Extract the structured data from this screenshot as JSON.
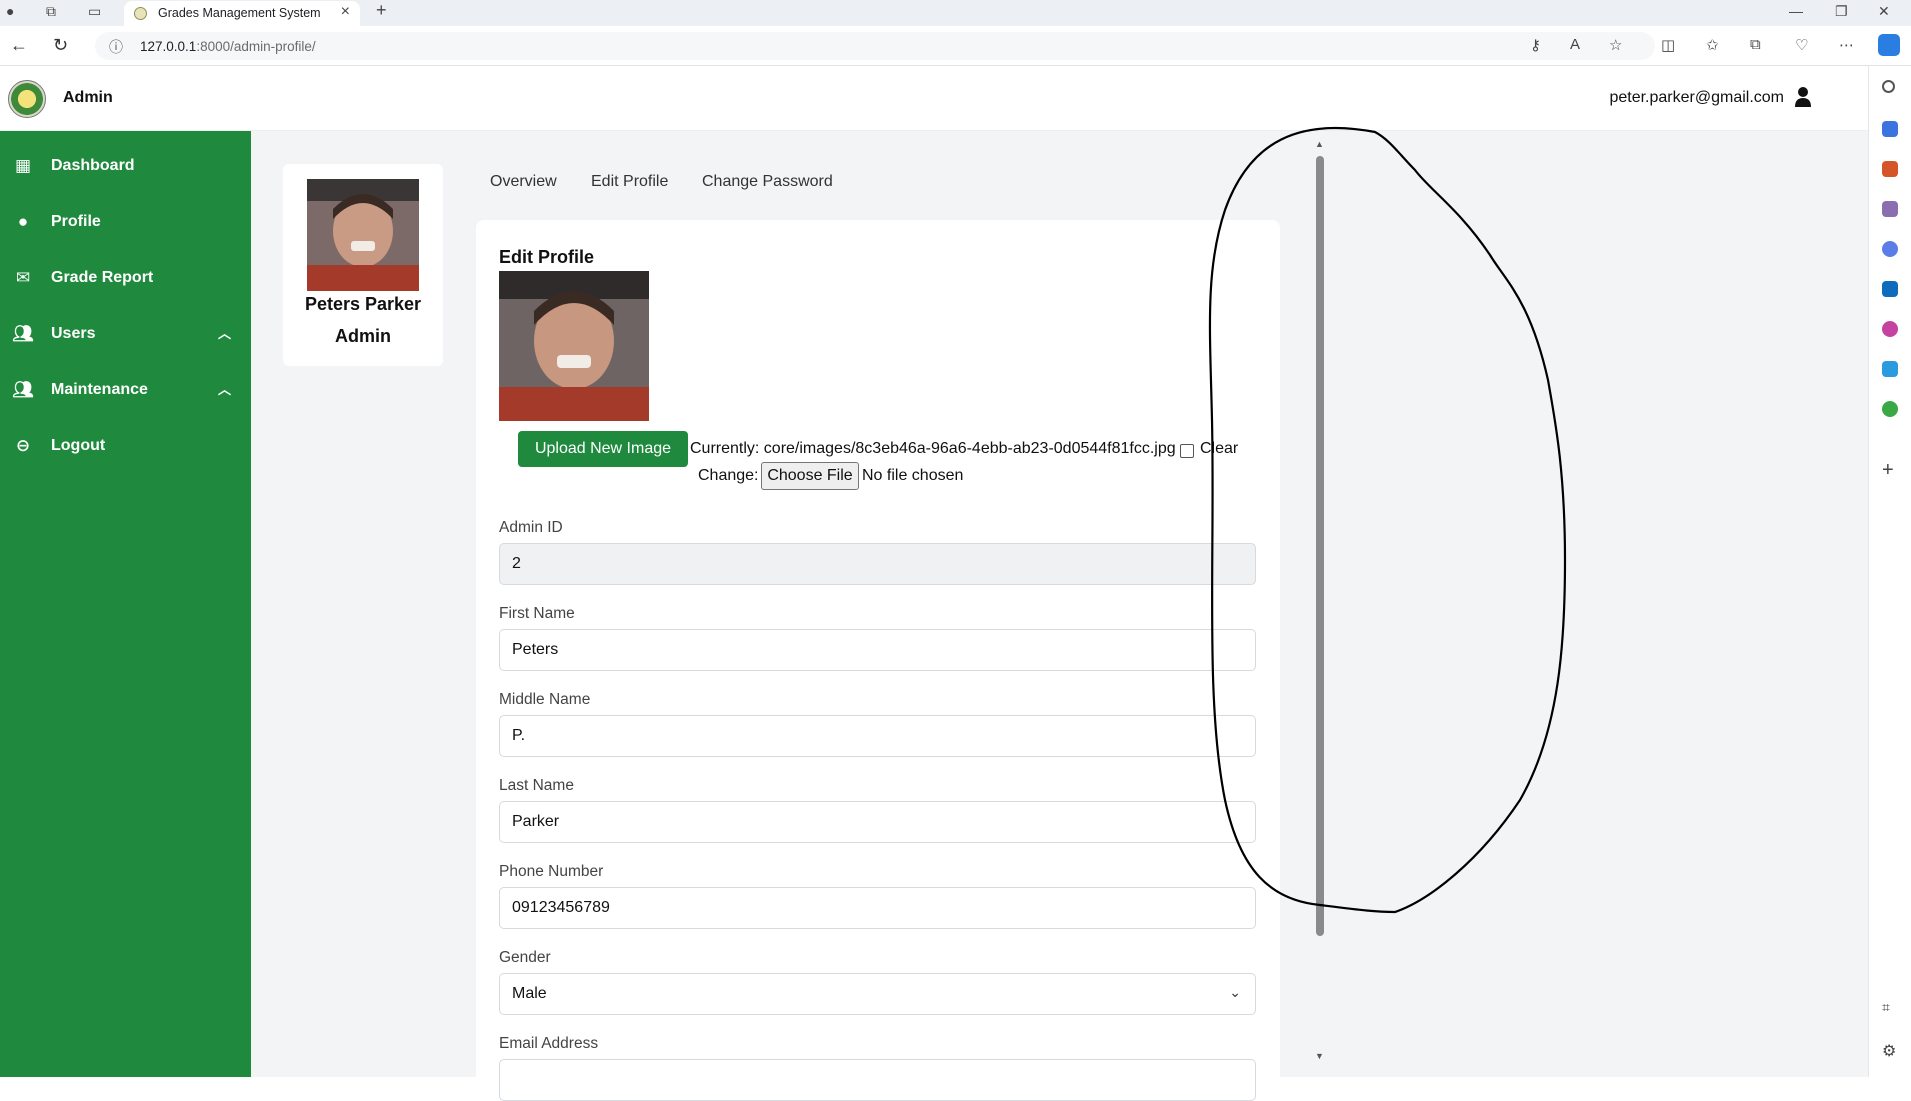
{
  "browser": {
    "tab_title": "Grades Management System",
    "url_host": "127.0.0.1",
    "url_rest": ":8000/admin-profile/",
    "new_tab_icon": "plus-icon"
  },
  "header": {
    "app_title": "Admin",
    "user_email": "peter.parker@gmail.com"
  },
  "sidebar": {
    "items": [
      {
        "label": "Dashboard",
        "icon": "dashboard-icon"
      },
      {
        "label": "Profile",
        "icon": "user-icon"
      },
      {
        "label": "Grade Report",
        "icon": "envelope-icon"
      },
      {
        "label": "Users",
        "icon": "users-icon"
      },
      {
        "label": "Maintenance",
        "icon": "users-icon"
      },
      {
        "label": "Logout",
        "icon": "logout-icon"
      }
    ]
  },
  "profile_card": {
    "name": "Peters Parker",
    "role": "Admin"
  },
  "tabs": [
    "Overview",
    "Edit Profile",
    "Change Password"
  ],
  "form": {
    "title": "Edit Profile",
    "upload_label": "Upload New Image",
    "currently_text": "Currently: core/images/8c3eb46a-96a6-4ebb-ab23-0d0544f81fcc.jpg",
    "clear_label": "Clear",
    "change_label": "Change:",
    "choose_file_label": "Choose File",
    "no_file_text": "No file chosen",
    "fields": [
      {
        "label": "Admin ID",
        "value": "2"
      },
      {
        "label": "First Name",
        "value": "Peters"
      },
      {
        "label": "Middle Name",
        "value": "P."
      },
      {
        "label": "Last Name",
        "value": "Parker"
      },
      {
        "label": "Phone Number",
        "value": "09123456789"
      },
      {
        "label": "Gender",
        "value": "Male"
      },
      {
        "label": "Email Address",
        "value": ""
      }
    ]
  },
  "colors": {
    "sidebar_green": "#1f8a3e",
    "page_bg": "#f3f4f6",
    "annotation_ink": "#000000"
  }
}
